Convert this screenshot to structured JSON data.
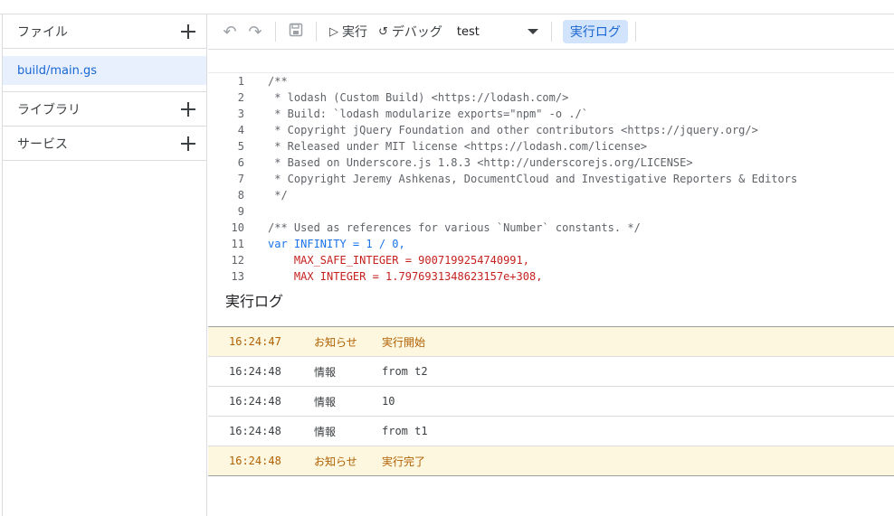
{
  "sidebar": {
    "files_label": "ファイル",
    "files": [
      "build/main.gs"
    ],
    "libraries_label": "ライブラリ",
    "services_label": "サービス"
  },
  "toolbar": {
    "run_label": "実行",
    "debug_label": "デバッグ",
    "function_selected": "test",
    "log_label": "実行ログ"
  },
  "editor": {
    "lines": [
      {
        "n": "1",
        "text": "/**"
      },
      {
        "n": "2",
        "text": " * lodash (Custom Build) <https://lodash.com/>"
      },
      {
        "n": "3",
        "text": " * Build: `lodash modularize exports=\"npm\" -o ./`"
      },
      {
        "n": "4",
        "text": " * Copyright jQuery Foundation and other contributors <https://jquery.org/>"
      },
      {
        "n": "5",
        "text": " * Released under MIT license <https://lodash.com/license>"
      },
      {
        "n": "6",
        "text": " * Based on Underscore.js 1.8.3 <http://underscorejs.org/LICENSE>"
      },
      {
        "n": "7",
        "text": " * Copyright Jeremy Ashkenas, DocumentCloud and Investigative Reporters & Editors"
      },
      {
        "n": "8",
        "text": " */"
      },
      {
        "n": "9",
        "text": ""
      },
      {
        "n": "10",
        "text": "/** Used as references for various `Number` constants. */"
      },
      {
        "n": "11",
        "text": "var INFINITY = 1 / 0,"
      },
      {
        "n": "12",
        "text": "    MAX_SAFE_INTEGER = 9007199254740991,"
      },
      {
        "n": "13",
        "text": "    MAX_INTEGER = 1.7976931348623157e+308,"
      }
    ]
  },
  "log": {
    "title": "実行ログ",
    "rows": [
      {
        "time": "16:24:47",
        "level": "お知らせ",
        "message": "実行開始",
        "kind": "notice"
      },
      {
        "time": "16:24:48",
        "level": "情報",
        "message": "from t2",
        "kind": "info"
      },
      {
        "time": "16:24:48",
        "level": "情報",
        "message": "10",
        "kind": "info"
      },
      {
        "time": "16:24:48",
        "level": "情報",
        "message": "from t1",
        "kind": "info"
      },
      {
        "time": "16:24:48",
        "level": "お知らせ",
        "message": "実行完了",
        "kind": "notice"
      }
    ]
  },
  "colors": {
    "accent": "#1a73e8",
    "selected_bg": "#e8f0fe",
    "notice_bg": "#fef7e0",
    "notice_text": "#b06000"
  },
  "icons": [
    "plus-icon",
    "undo-icon",
    "redo-icon",
    "save-icon",
    "play-icon",
    "debug-icon",
    "caret-down-icon"
  ]
}
